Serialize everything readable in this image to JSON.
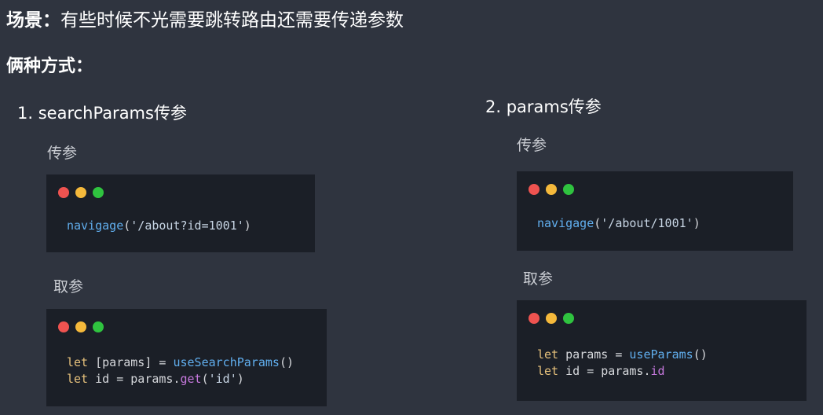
{
  "scene": {
    "label": "场景：",
    "text": "有些时候不光需要跳转路由还需要传递参数"
  },
  "ways_title": "俩种方式：",
  "left": {
    "title": "1. searchParams传参",
    "pass_label": "传参",
    "get_label": "取参",
    "pass_code": {
      "fn": "navigage",
      "open": "(",
      "arg": "'/about?id=1001'",
      "close": ")"
    },
    "get_code": {
      "line1": {
        "kw": "let",
        "a": " [params] = ",
        "fn": "useSearchParams",
        "b": "()"
      },
      "line2": {
        "kw": "let",
        "a": " id = params.",
        "prop": "get",
        "b": "(",
        "arg": "'id'",
        "c": ")"
      }
    }
  },
  "right": {
    "title": "2. params传参",
    "pass_label": "传参",
    "get_label": "取参",
    "pass_code": {
      "fn": "navigage",
      "open": "(",
      "arg": "'/about/1001'",
      "close": ")"
    },
    "get_code": {
      "line1": {
        "kw": "let",
        "a": " params = ",
        "fn": "useParams",
        "b": "()"
      },
      "line2": {
        "kw": "let",
        "a": " id = params.",
        "prop": "id"
      }
    }
  },
  "colors": {
    "background": "#2f343f",
    "code_bg": "#1b1f27",
    "dot_red": "#ef5350",
    "dot_yellow": "#f5b93b",
    "dot_green": "#2fc33f"
  }
}
